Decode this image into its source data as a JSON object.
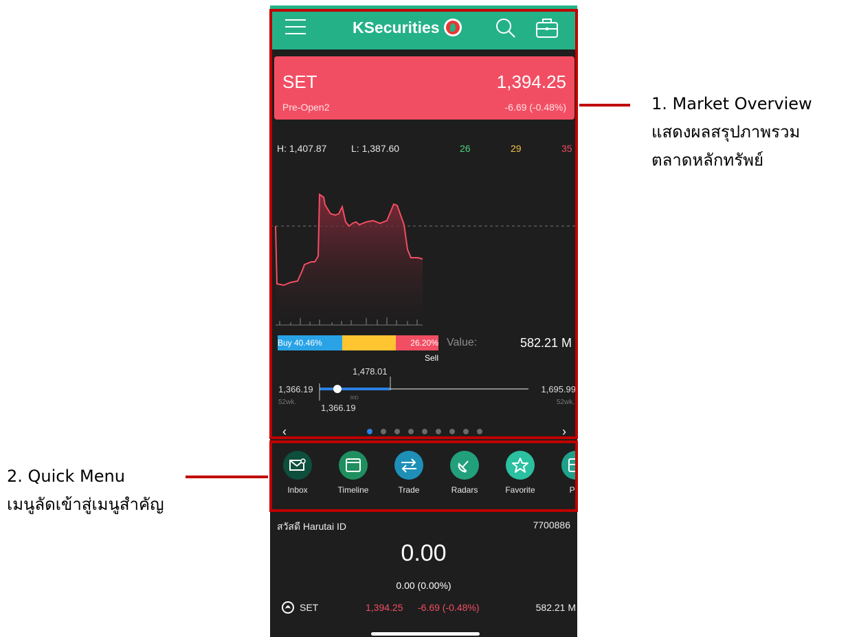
{
  "header": {
    "logo_text": "KSecurities",
    "icons": [
      "menu-icon",
      "search-icon",
      "briefcase-icon"
    ],
    "brand_color": "#25b187"
  },
  "market": {
    "index_name": "SET",
    "index_value": "1,394.25",
    "status": "Pre-Open2",
    "change": "-6.69 (-0.48%)",
    "high": "H: 1,407.87",
    "low": "L: 1,387.60",
    "advances": "26",
    "unchanged": "29",
    "declines": "35",
    "buy_label": "Buy 40.46%",
    "sell_label": "26.20% Sell",
    "value_label": "Value:",
    "value": "582.21 M"
  },
  "range": {
    "low_52wk": "1,366.19",
    "low_52wk_label": "52wk.",
    "high_52wk": "1,695.99",
    "high_52wk_label": "52wk.",
    "high_30d": "1,478.01",
    "low_30d": "1,366.19",
    "label_30d": "30D"
  },
  "pager": {
    "prev": "‹",
    "next": "›",
    "active_index": 0,
    "count": 9
  },
  "quick_menu": [
    {
      "label": "Inbox",
      "icon": "inbox-icon",
      "color": "#0d4f3c"
    },
    {
      "label": "Timeline",
      "icon": "timeline-icon",
      "color": "#1f8f5f"
    },
    {
      "label": "Trade",
      "icon": "trade-icon",
      "color": "#1e90b8"
    },
    {
      "label": "Radars",
      "icon": "radar-icon",
      "color": "#22a07c"
    },
    {
      "label": "Favorite",
      "icon": "favorite-icon",
      "color": "#2bc0a0"
    },
    {
      "label": "Por",
      "icon": "portfolio-icon",
      "color": "#1fa08a"
    }
  ],
  "account": {
    "greeting": "สวัสดี Harutai ID",
    "account_no": "7700886",
    "balance": "0.00",
    "balance_change": "0.00 (0.00%)"
  },
  "ticker": {
    "name": "SET",
    "price": "1,394.25",
    "change": "-6.69 (-0.48%)",
    "value": "582.21 M"
  },
  "annotations": {
    "a1_title": "1. Market Overview",
    "a1_line2": "แสดงผลสรุปภาพรวม",
    "a1_line3": "ตลาดหลักทรัพย์",
    "a2_title": "2. Quick Menu",
    "a2_line2": "เมนูลัดเข้าสู่เมนูสำคัญ"
  },
  "colors": {
    "up": "#4cd37c",
    "unchanged": "#f2c24a",
    "down": "#f24e63",
    "buy": "#29a3e6",
    "neutral": "#ffc531",
    "sell": "#f24e63",
    "annotation": "#c00000"
  }
}
